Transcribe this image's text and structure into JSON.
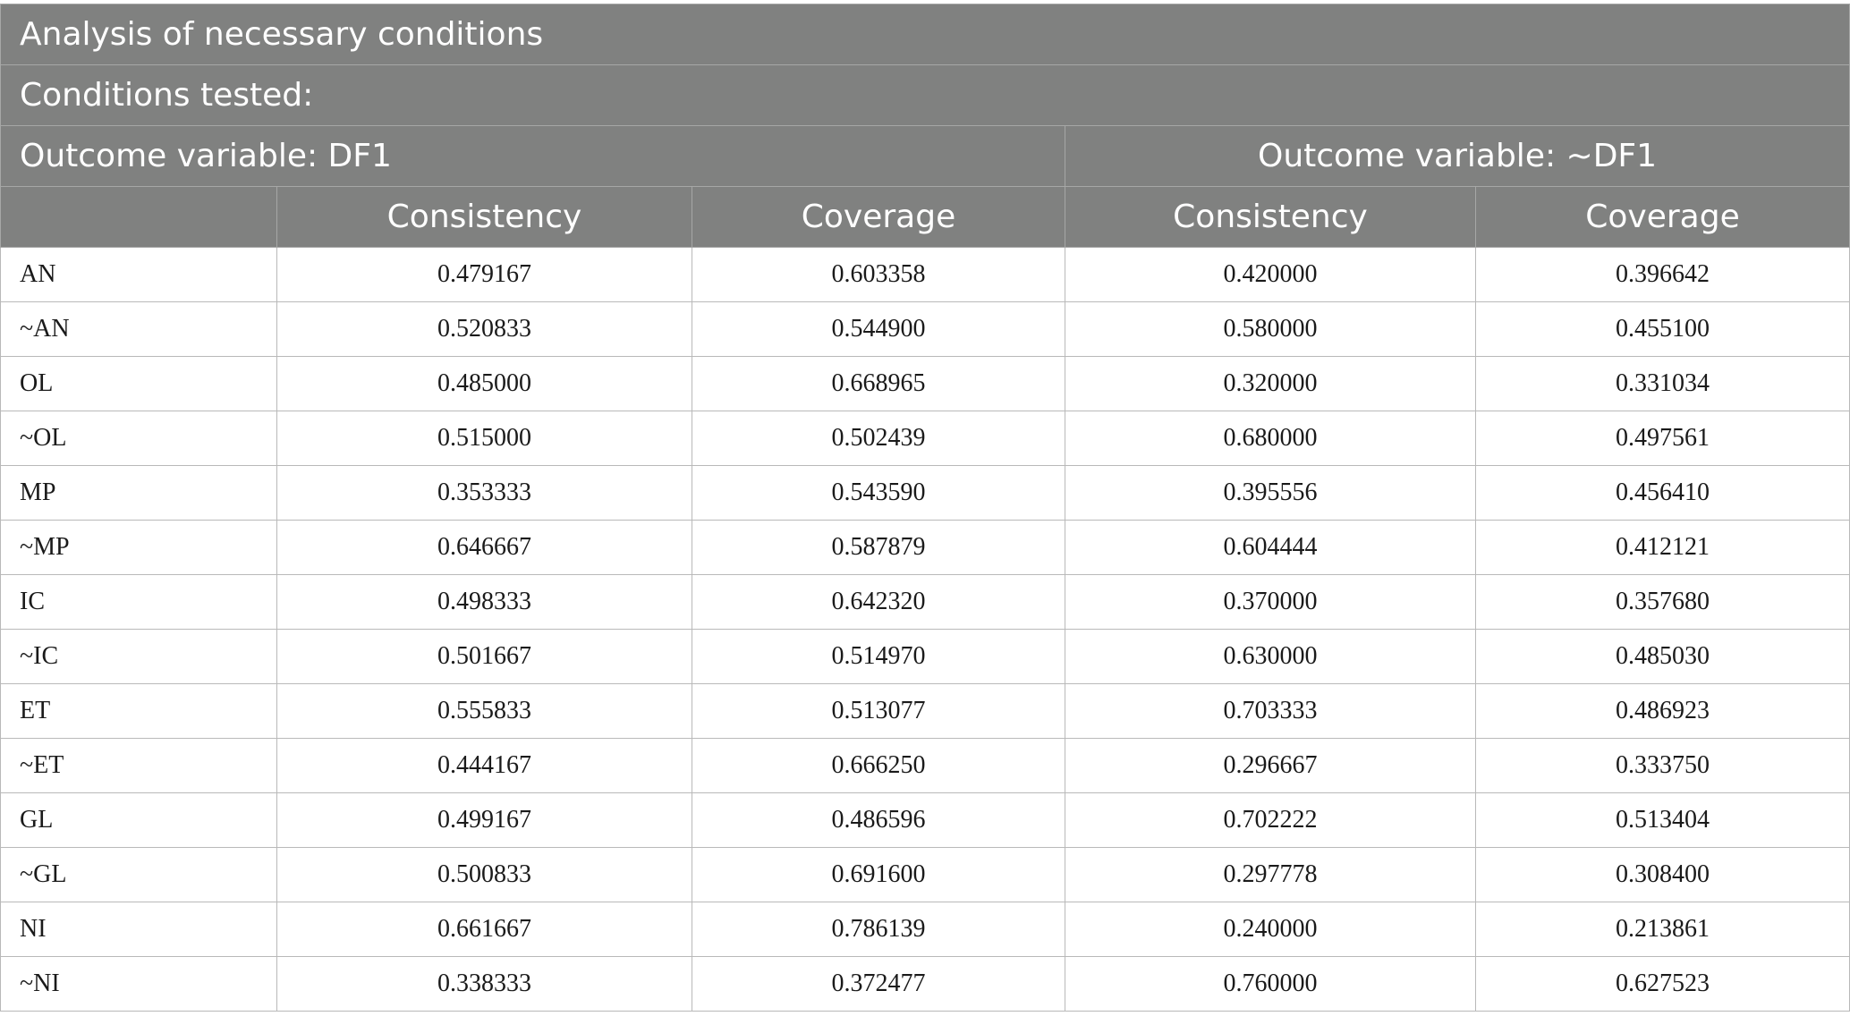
{
  "header": {
    "title": "Analysis of necessary conditions",
    "conditions_tested": "Conditions tested:",
    "outcome_df1": "Outcome variable: DF1",
    "outcome_not_df1": "Outcome variable: ~DF1",
    "col_consistency": "Consistency",
    "col_coverage": "Coverage"
  },
  "rows": [
    {
      "condition": "AN",
      "cons1": "0.479167",
      "cov1": "0.603358",
      "cons2": "0.420000",
      "cov2": "0.396642"
    },
    {
      "condition": "~AN",
      "cons1": "0.520833",
      "cov1": "0.544900",
      "cons2": "0.580000",
      "cov2": "0.455100"
    },
    {
      "condition": "OL",
      "cons1": "0.485000",
      "cov1": "0.668965",
      "cons2": "0.320000",
      "cov2": "0.331034"
    },
    {
      "condition": "~OL",
      "cons1": "0.515000",
      "cov1": "0.502439",
      "cons2": "0.680000",
      "cov2": "0.497561"
    },
    {
      "condition": "MP",
      "cons1": "0.353333",
      "cov1": "0.543590",
      "cons2": "0.395556",
      "cov2": "0.456410"
    },
    {
      "condition": "~MP",
      "cons1": "0.646667",
      "cov1": "0.587879",
      "cons2": "0.604444",
      "cov2": "0.412121"
    },
    {
      "condition": "IC",
      "cons1": "0.498333",
      "cov1": "0.642320",
      "cons2": "0.370000",
      "cov2": "0.357680"
    },
    {
      "condition": "~IC",
      "cons1": "0.501667",
      "cov1": "0.514970",
      "cons2": "0.630000",
      "cov2": "0.485030"
    },
    {
      "condition": "ET",
      "cons1": "0.555833",
      "cov1": "0.513077",
      "cons2": "0.703333",
      "cov2": "0.486923"
    },
    {
      "condition": "~ET",
      "cons1": "0.444167",
      "cov1": "0.666250",
      "cons2": "0.296667",
      "cov2": "0.333750"
    },
    {
      "condition": "GL",
      "cons1": "0.499167",
      "cov1": "0.486596",
      "cons2": "0.702222",
      "cov2": "0.513404"
    },
    {
      "condition": "~GL",
      "cons1": "0.500833",
      "cov1": "0.691600",
      "cons2": "0.297778",
      "cov2": "0.308400"
    },
    {
      "condition": "NI",
      "cons1": "0.661667",
      "cov1": "0.786139",
      "cons2": "0.240000",
      "cov2": "0.213861"
    },
    {
      "condition": "~NI",
      "cons1": "0.338333",
      "cov1": "0.372477",
      "cons2": "0.760000",
      "cov2": "0.627523"
    }
  ]
}
